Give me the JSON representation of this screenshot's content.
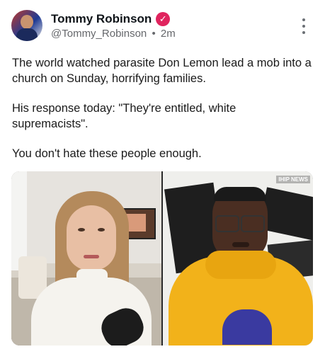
{
  "author": {
    "name": "Tommy Robinson",
    "verified_icon": "verified-badge-icon",
    "handle": "@Tommy_Robinson",
    "separator": "•",
    "time": "2m",
    "avatar_icon": "profile-photo"
  },
  "menu_icon": "more-vertical-icon",
  "post": {
    "paragraphs": [
      "The world watched parasite Don Lemon lead a mob into a church on Sunday, horrifying families.",
      "His response today: \"They're entitled, white supremacists\".",
      "You don't hate these people enough."
    ]
  },
  "media": {
    "description_icons": [
      "video-call-left-woman",
      "video-call-right-man"
    ],
    "watermark": "IHIP NEWS"
  },
  "colors": {
    "badge": "#e0245e",
    "meta_text": "#65676b",
    "hoodie": "#f2b21a"
  }
}
